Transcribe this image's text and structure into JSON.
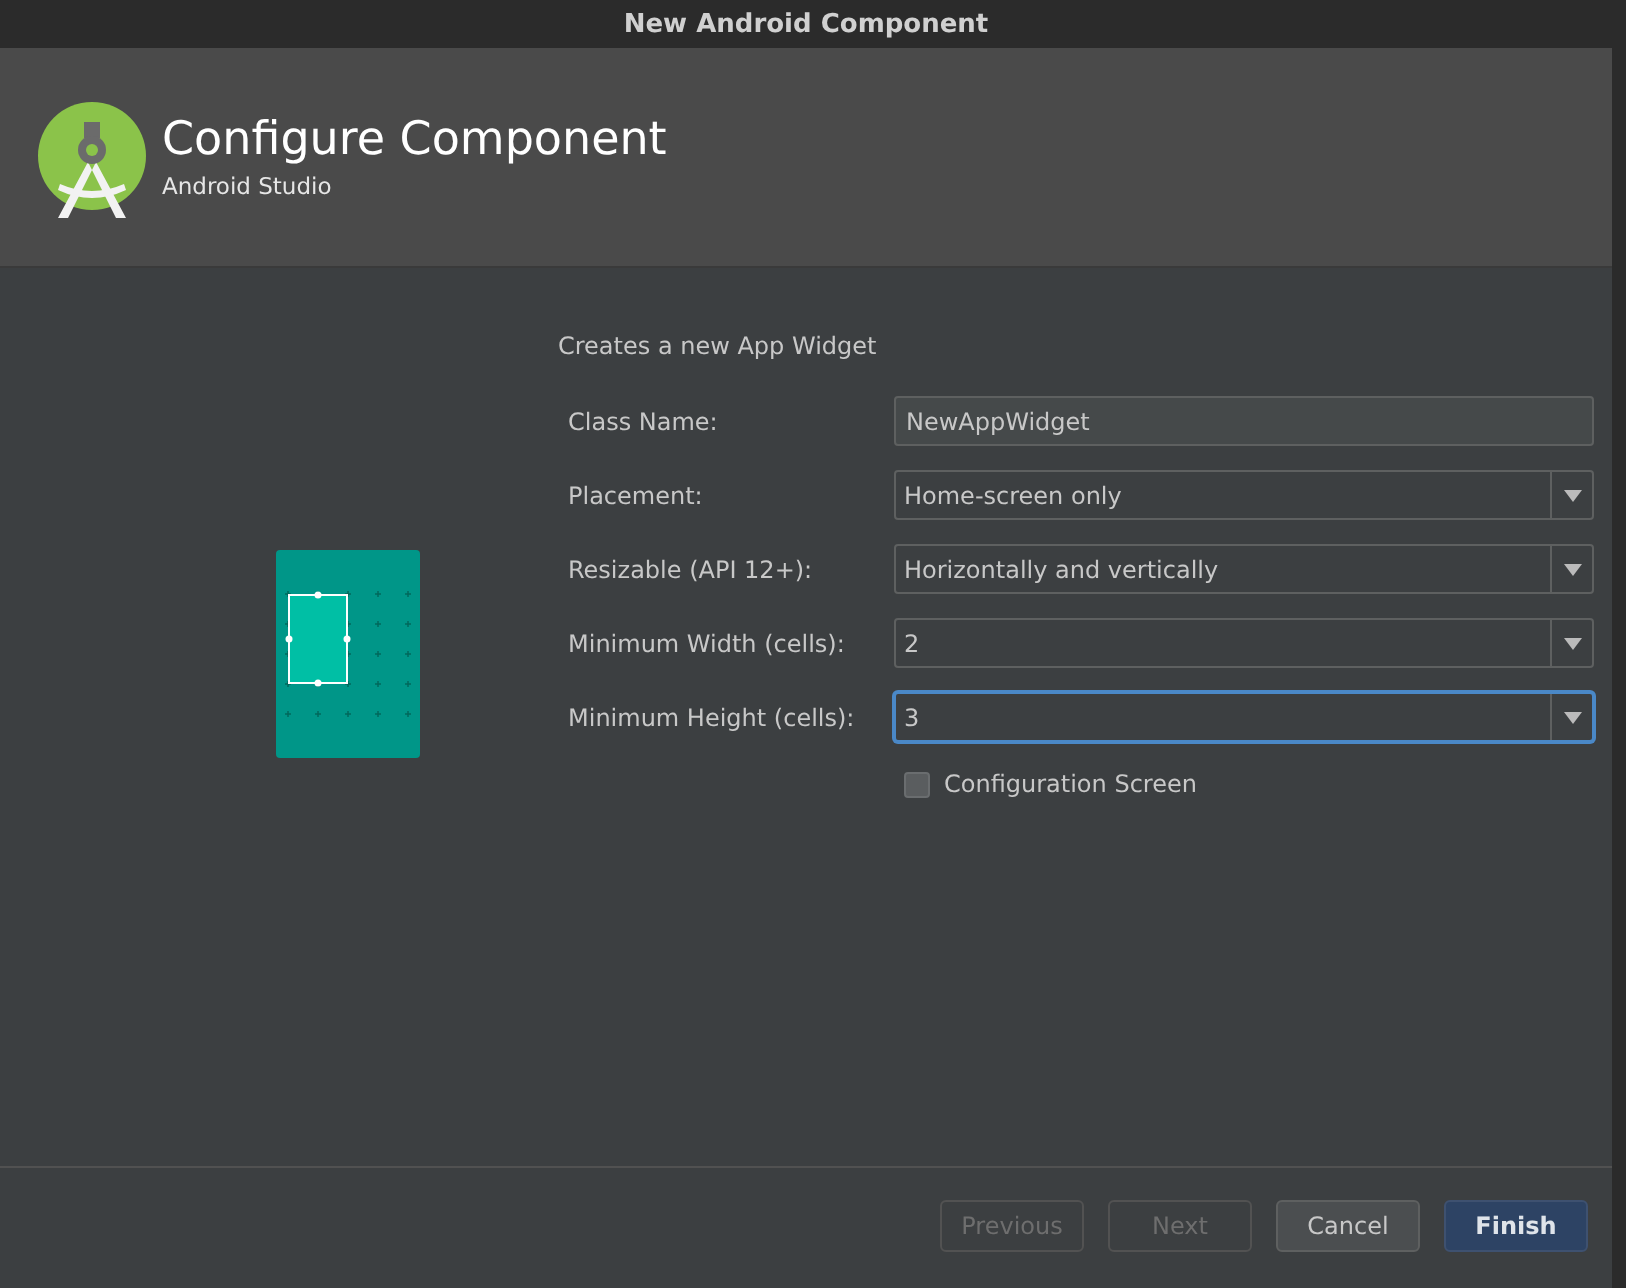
{
  "window": {
    "title": "New Android Component"
  },
  "header": {
    "title": "Configure Component",
    "subtitle": "Android Studio"
  },
  "description": "Creates a new App Widget",
  "fields": [
    {
      "kind": "text",
      "label": "Class Name:",
      "value": "NewAppWidget",
      "focused": false
    },
    {
      "kind": "combo",
      "label": "Placement:",
      "value": "Home-screen only",
      "focused": false
    },
    {
      "kind": "combo",
      "label": "Resizable (API 12+):",
      "value": "Horizontally and vertically",
      "focused": false
    },
    {
      "kind": "combo",
      "label": "Minimum Width (cells):",
      "value": "2",
      "focused": false
    },
    {
      "kind": "combo",
      "label": "Minimum Height (cells):",
      "value": "3",
      "focused": true
    }
  ],
  "checkbox": {
    "label": "Configuration Screen",
    "checked": false
  },
  "buttons": [
    {
      "label": "Previous",
      "disabled": true,
      "primary": false
    },
    {
      "label": "Next",
      "disabled": true,
      "primary": false
    },
    {
      "label": "Cancel",
      "disabled": false,
      "primary": false
    },
    {
      "label": "Finish",
      "disabled": false,
      "primary": true
    }
  ]
}
